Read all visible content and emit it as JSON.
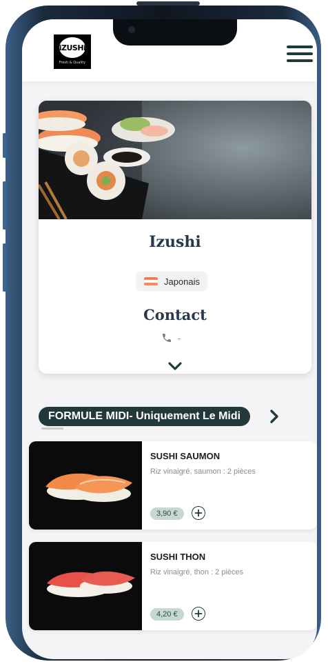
{
  "header": {
    "logo_word": "iZUSHi",
    "logo_tagline": "Fresh & Quality",
    "menu_icon": "hamburger-menu-icon"
  },
  "restaurant": {
    "name": "Izushi",
    "cuisine": "Japonais",
    "cuisine_icon": "sushi-icon",
    "contact_title": "Contact",
    "phone_icon": "phone-icon",
    "phone_value": "-",
    "expand_icon": "chevron-down-icon"
  },
  "section": {
    "title": "FORMULE MIDI- Uniquement Le Midi",
    "next_icon": "chevron-right-icon"
  },
  "items": [
    {
      "name": "SUSHI SAUMON",
      "description": "Riz vinaigré, saumon : 2 pièces",
      "price": "3,90 €",
      "add_icon": "plus-icon"
    },
    {
      "name": "SUSHI THON",
      "description": "Riz vinaigré, thon : 2 pièces",
      "price": "4,20 €",
      "add_icon": "plus-icon"
    }
  ],
  "colors": {
    "accent_dark": "#1f3b38",
    "title_text": "#26384a",
    "price_badge": "#c7d7d2",
    "phone_frame": "#3e6590"
  }
}
